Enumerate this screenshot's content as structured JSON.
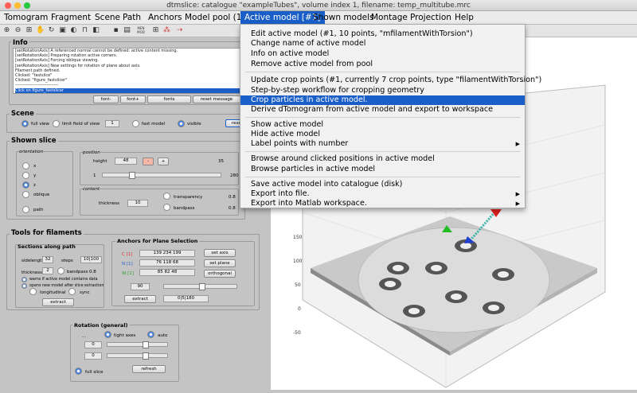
{
  "window": {
    "title": "dtmslice: catalogue \"exampleTubes\", volume index 1, filename: temp_multitube.mrc"
  },
  "menubar": {
    "items": [
      "Tomogram",
      "Fragment",
      "Scene",
      "Path",
      "Anchors",
      "Model pool (1)",
      "Active model [#1]",
      "Shown models",
      "Montage",
      "Projection",
      "Help"
    ]
  },
  "dropdown": {
    "items": [
      "Edit active model (#1, 10 points, \"mfilamentWithTorsion\")",
      "Change name of active model",
      "Info on active model",
      "Remove active model from pool",
      "Update crop points (#1, currently 7 crop points, type \"filamentWithTorsion\")",
      "Step-by-step workflow for cropping geometry",
      "Crop particles in active model.",
      "Derive dTomogram from active model and export to workspace",
      "Show active model",
      "Hide active model",
      "Label points with number",
      "Browse around clicked positions in active model",
      "Browse particles in active model",
      "Save active model into catalogue (disk)",
      "Export into file.",
      "Export into Matlab workspace."
    ],
    "submenu_arrow": "▶"
  },
  "info": {
    "title": "Info",
    "log": [
      "[setRotationAxis] A referenced normal cannot be defined: active content missing.",
      "[setRotationAxis] Preparing rotation active corners.",
      "[setRotationAxis] Forcing oblique viewing.",
      "[setRotationAxis] New settings for rotation of plane about axis.",
      "Filament path defined.",
      "Clicked: \"fastslice\"",
      "Clicked: \"figure_fastslicer\"",
      "------------------------------",
      "Click on figure_fastslicer"
    ],
    "buttons": [
      "font-",
      "font+",
      "fonts",
      "reset message"
    ]
  },
  "scene": {
    "title": "Scene",
    "opts": [
      "full view",
      "limit field of view",
      "fast model",
      "visible"
    ],
    "fov_value": "1",
    "reset": "reset"
  },
  "shown_slice": {
    "title": "Shown slice",
    "orientation": "orientation",
    "axes": [
      "x",
      "y",
      "z",
      "oblique",
      "path"
    ],
    "position": "position",
    "height": "height",
    "height_val": "48",
    "max": "35",
    "min": "1",
    "max2": "280",
    "content": "content",
    "thickness": "thickness",
    "thickness_val": "10",
    "transparency": "transparency",
    "transparency_val": "0.8",
    "bandpass": "bandpass",
    "bandpass_val": "0.8"
  },
  "tools": {
    "title": "Tools for filaments",
    "sections": "Sections along path",
    "sidelength": "sidelength",
    "side_val": "32",
    "steps": "steps",
    "steps_val": "10|100",
    "thickness": "thickness",
    "thick_val": "2",
    "bandpass": "bandpass",
    "band_val": "0.8",
    "chk1": "warns if active model contains data",
    "chk2": "opens new model after slice extraction",
    "longitudinal": "longitudinal",
    "sync": "sync",
    "extract": "extract"
  },
  "anchors": {
    "title": "Anchors for Plane Selection",
    "labels": [
      "C [1]",
      "N [1]",
      "W [1]"
    ],
    "values": [
      "139 234 199",
      "76 118 68",
      "85 82 48"
    ],
    "buttons": [
      "set axis",
      "set plane",
      "orthogonal"
    ],
    "angle": "90",
    "extract": "extract",
    "extract_val": "0|5|180"
  },
  "rotation": {
    "title": "Rotation (general)",
    "dots": "...",
    "tight": "tight axes",
    "auto": "auto",
    "v1": "0",
    "v2": "0",
    "full": "full slice",
    "refresh": "refresh"
  },
  "plot": {
    "yticks": [
      "150",
      "100",
      "50",
      "0",
      "-50"
    ]
  }
}
